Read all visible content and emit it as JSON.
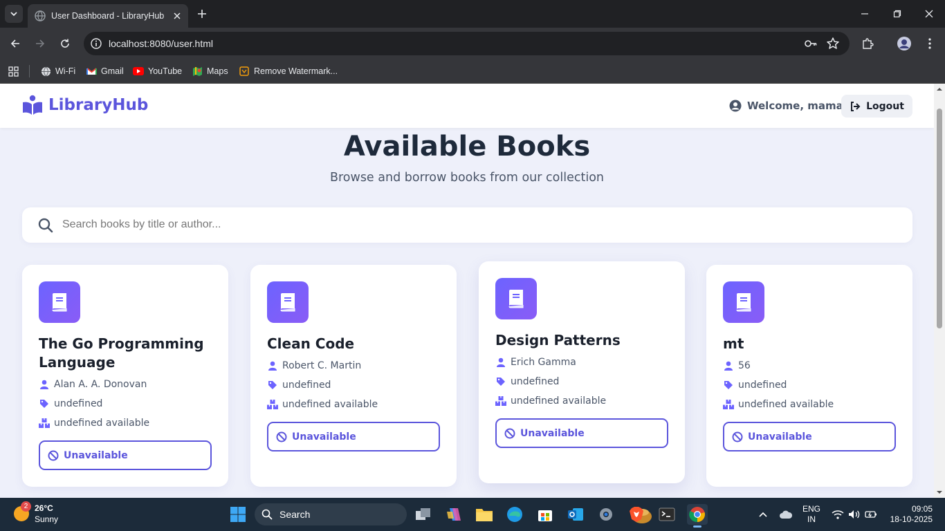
{
  "browser": {
    "tab_title": "User Dashboard - LibraryHub",
    "url": "localhost:8080/user.html",
    "bookmarks": [
      "Wi-Fi",
      "Gmail",
      "YouTube",
      "Maps",
      "Remove Watermark..."
    ]
  },
  "app": {
    "brand": "LibraryHub",
    "welcome": "Welcome, mama",
    "logout": "Logout",
    "heading": "Available Books",
    "subheading": "Browse and borrow books from our collection",
    "search_placeholder": "Search books by title or author..."
  },
  "books": [
    {
      "title": "The Go Programming Language",
      "author": "Alan A. A. Donovan",
      "category": "undefined",
      "availability": "undefined available",
      "status": "Unavailable"
    },
    {
      "title": "Clean Code",
      "author": "Robert C. Martin",
      "category": "undefined",
      "availability": "undefined available",
      "status": "Unavailable"
    },
    {
      "title": "Design Patterns",
      "author": "Erich Gamma",
      "category": "undefined",
      "availability": "undefined available",
      "status": "Unavailable"
    },
    {
      "title": "mt",
      "author": "56",
      "category": "undefined",
      "availability": "undefined available",
      "status": "Unavailable"
    }
  ],
  "taskbar": {
    "weather_temp": "26°C",
    "weather_desc": "Sunny",
    "weather_badge": "2",
    "search_label": "Search",
    "lang": "ENG",
    "region": "IN",
    "time": "09:05",
    "date": "18-10-2025"
  },
  "colors": {
    "accent": "#5b55dc",
    "page_bg": "#eef0fa"
  }
}
